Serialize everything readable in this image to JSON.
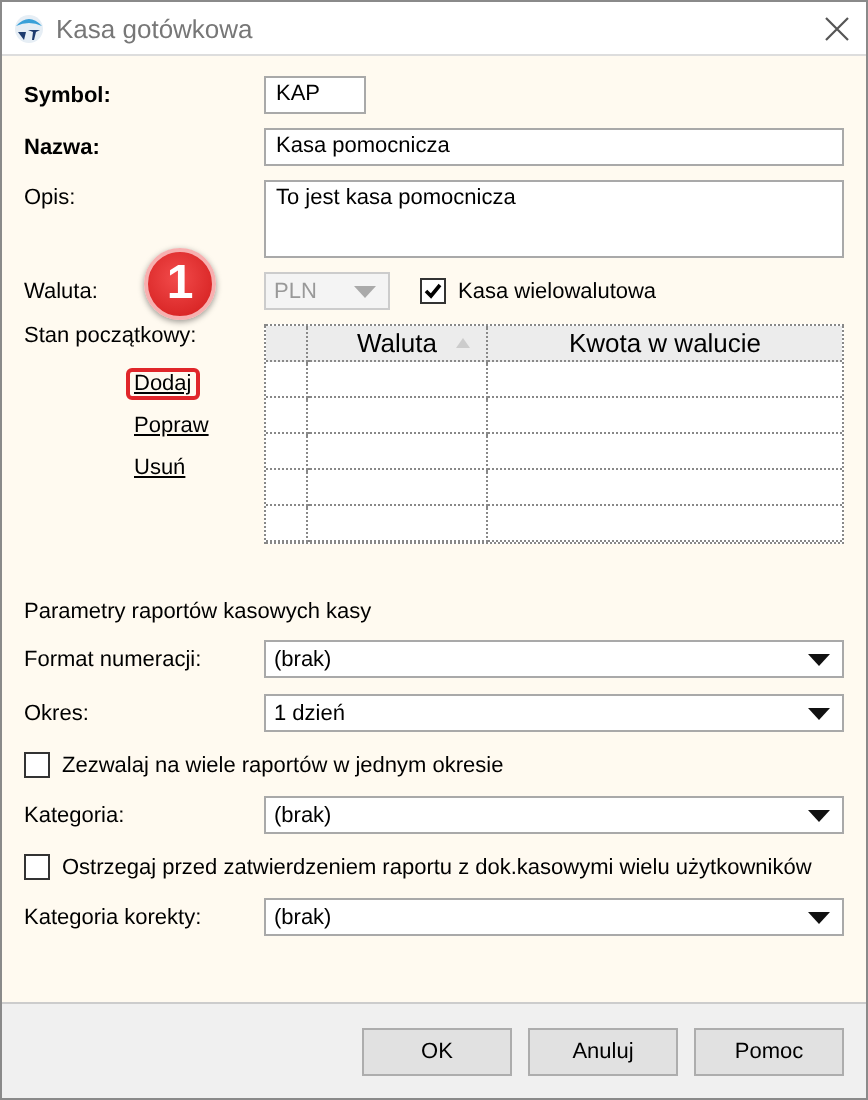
{
  "window": {
    "title": "Kasa gotówkowa"
  },
  "fields": [
    {
      "kind": "code",
      "label": "Symbol:",
      "bold": true,
      "value": "KAP"
    },
    {
      "kind": "text",
      "label": "Nazwa:",
      "bold": true,
      "value": "Kasa pomocnicza"
    },
    {
      "kind": "memo",
      "label": "Opis:",
      "bold": false,
      "value": "To jest kasa pomocnicza"
    }
  ],
  "currency": {
    "label": "Waluta:",
    "value": "PLN",
    "disabled": true
  },
  "multi_currency": {
    "label": "Kasa wielowalutowa",
    "checked": true
  },
  "opening_balance": {
    "label": "Stan początkowy:",
    "badge": "1",
    "actions": [
      {
        "label": "Dodaj",
        "highlighted": true
      },
      {
        "label": "Popraw",
        "highlighted": false
      },
      {
        "label": "Usuń",
        "highlighted": false
      }
    ],
    "columns": [
      {
        "label": "Waluta",
        "sorted": true
      },
      {
        "label": "Kwota w walucie",
        "sorted": false
      }
    ]
  },
  "report_params": {
    "title": "Parametry raportów kasowych kasy",
    "items": [
      {
        "kind": "select",
        "label": "Format numeracji:",
        "value": "(brak)"
      },
      {
        "kind": "select",
        "label": "Okres:",
        "value": "1 dzień"
      },
      {
        "kind": "checkbox",
        "label": "Zezwalaj na wiele raportów w jednym okresie",
        "checked": false
      },
      {
        "kind": "select",
        "label": "Kategoria:",
        "value": "(brak)"
      },
      {
        "kind": "checkbox",
        "label": "Ostrzegaj przed zatwierdzeniem raportu z dok.kasowymi wielu użytkowników",
        "checked": false
      },
      {
        "kind": "select",
        "label": "Kategoria korekty:",
        "value": "(brak)"
      }
    ]
  },
  "buttons": [
    {
      "label": "OK"
    },
    {
      "label": "Anuluj"
    },
    {
      "label": "Pomoc"
    }
  ]
}
